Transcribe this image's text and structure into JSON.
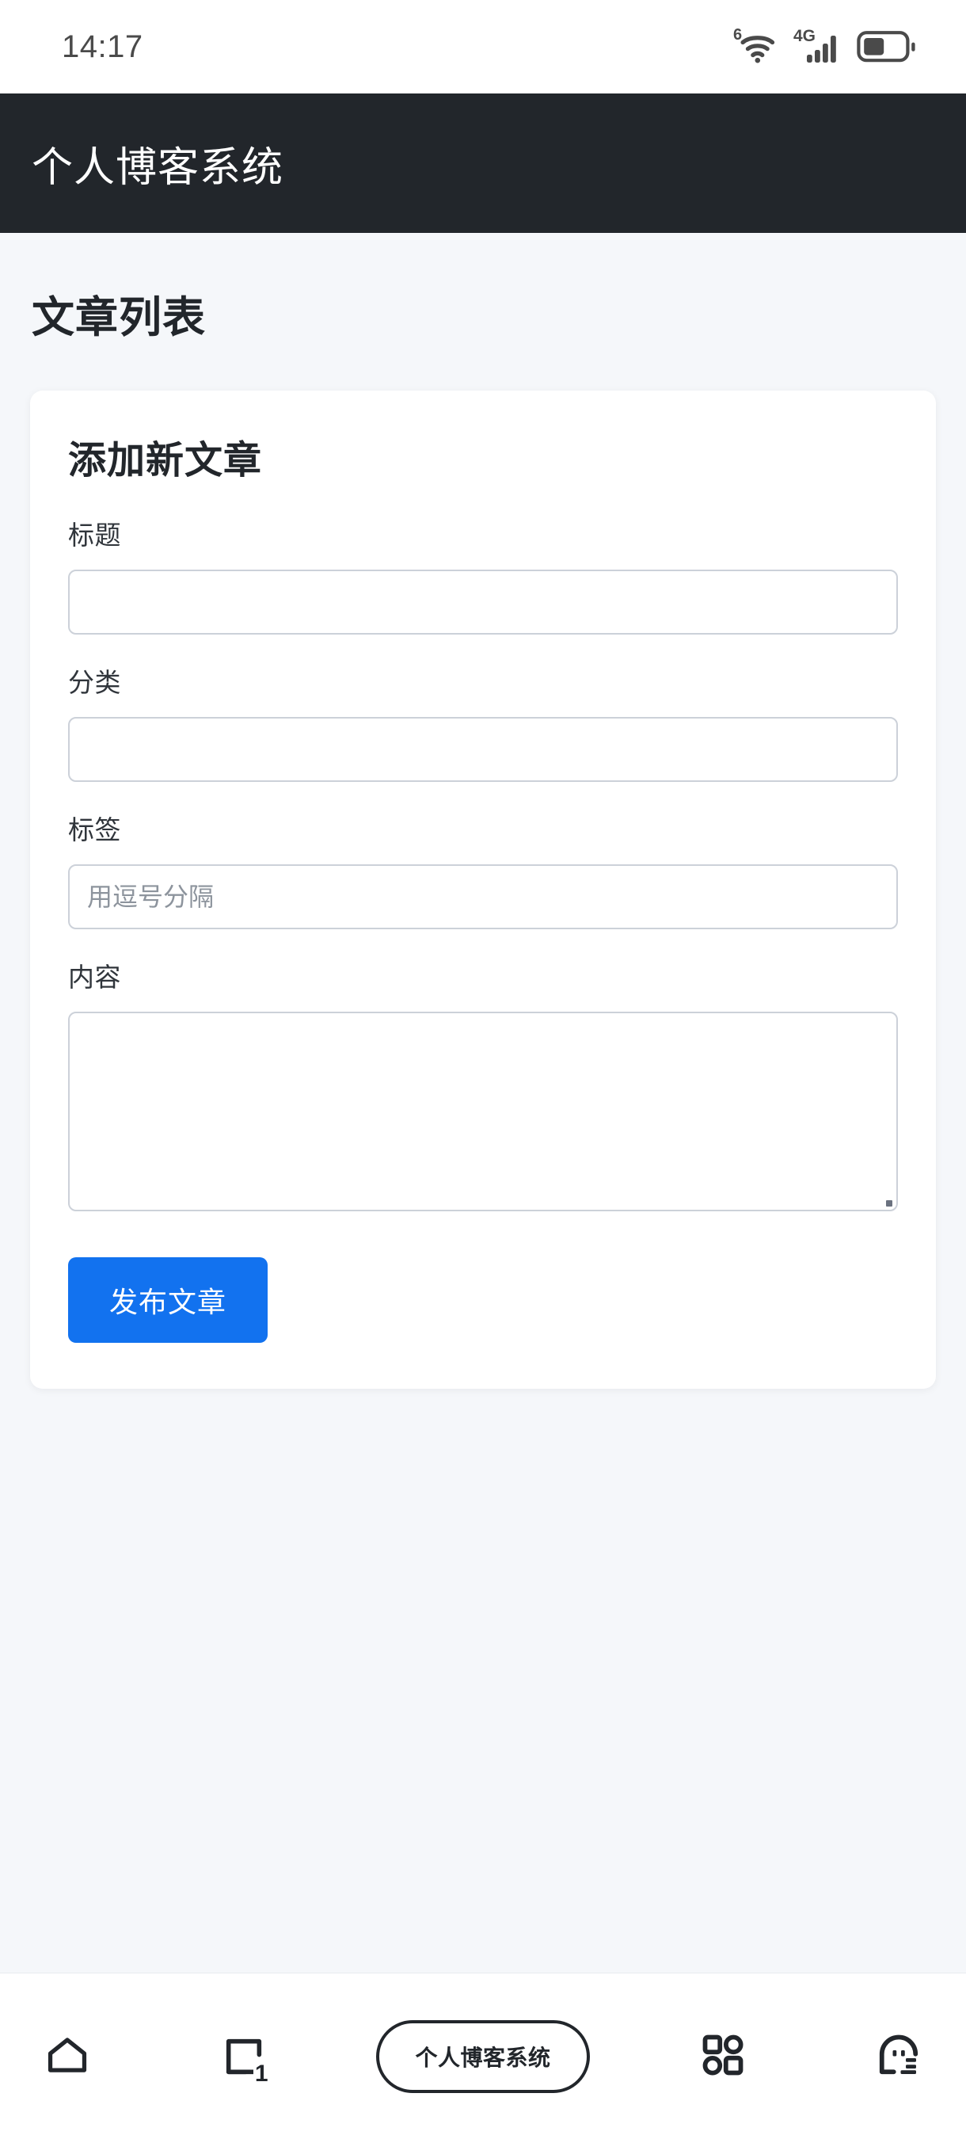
{
  "status_bar": {
    "time": "14:17",
    "wifi_generation": "6",
    "network_type": "4G",
    "wifi_icon": "wifi-icon",
    "signal_icon": "signal-bars-icon",
    "battery_icon": "battery-icon"
  },
  "app_header": {
    "title": "个人博客系统"
  },
  "page": {
    "title": "文章列表"
  },
  "form_card": {
    "title": "添加新文章",
    "fields": [
      {
        "label": "标题",
        "value": "",
        "placeholder": "",
        "type": "text"
      },
      {
        "label": "分类",
        "value": "",
        "placeholder": "",
        "type": "text"
      },
      {
        "label": "标签",
        "value": "",
        "placeholder": "用逗号分隔",
        "type": "text"
      },
      {
        "label": "内容",
        "value": "",
        "placeholder": "",
        "type": "textarea"
      }
    ],
    "submit_label": "发布文章"
  },
  "bottom_nav": {
    "home_icon": "home-icon",
    "tabs_icon": "tab-switcher-icon",
    "tab_count": "1",
    "pill_label": "个人博客系统",
    "apps_icon": "apps-grid-icon",
    "menu_icon": "profile-menu-icon"
  },
  "colors": {
    "header_bg": "#22262b",
    "page_bg": "#f5f7fa",
    "card_bg": "#ffffff",
    "accent": "#1272ef",
    "text_primary": "#22262b",
    "input_border": "#ccd1d9",
    "placeholder": "#8d949d"
  }
}
